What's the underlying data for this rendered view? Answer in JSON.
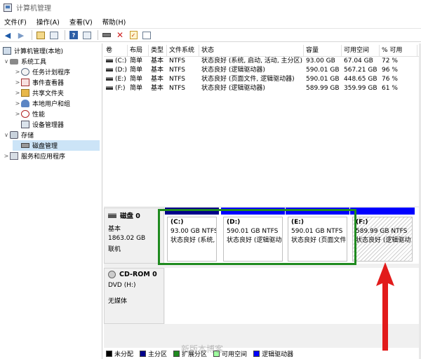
{
  "window": {
    "title": "计算机管理"
  },
  "menu": [
    "文件(F)",
    "操作(A)",
    "查看(V)",
    "帮助(H)"
  ],
  "toolbar": {
    "icons": [
      "back-arrow-icon",
      "forward-arrow-icon",
      "up-folder-icon",
      "show-hide-tree-icon",
      "help-icon",
      "properties-icon",
      "connect-drive-icon",
      "delete-icon",
      "checklist-icon",
      "panel-icon"
    ]
  },
  "tree": {
    "root": "计算机管理(本地)",
    "system_tools": "系统工具",
    "task_scheduler": "任务计划程序",
    "event_viewer": "事件查看器",
    "shared_folders": "共享文件夹",
    "local_users": "本地用户和组",
    "performance": "性能",
    "device_manager": "设备管理器",
    "storage": "存储",
    "disk_management": "磁盘管理",
    "services_apps": "服务和应用程序"
  },
  "volume_table": {
    "headers": [
      "卷",
      "布局",
      "类型",
      "文件系统",
      "状态",
      "容量",
      "可用空间",
      "% 可用"
    ],
    "rows": [
      [
        "(C:)",
        "简单",
        "基本",
        "NTFS",
        "状态良好 (系统, 启动, 活动, 主分区)",
        "93.00 GB",
        "67.04 GB",
        "72 %"
      ],
      [
        "(D:)",
        "简单",
        "基本",
        "NTFS",
        "状态良好 (逻辑驱动器)",
        "590.01 GB",
        "567.21 GB",
        "96 %"
      ],
      [
        "(E:)",
        "简单",
        "基本",
        "NTFS",
        "状态良好 (页面文件, 逻辑驱动器)",
        "590.01 GB",
        "448.65 GB",
        "76 %"
      ],
      [
        "(F:)",
        "简单",
        "基本",
        "NTFS",
        "状态良好 (逻辑驱动器)",
        "589.99 GB",
        "359.99 GB",
        "61 %"
      ]
    ]
  },
  "disk0": {
    "name": "磁盘 0",
    "type": "基本",
    "size": "1863.02 GB",
    "status": "联机",
    "partitions": [
      {
        "label": "(C:)",
        "size": "93.00 GB NTFS",
        "status": "状态良好 (系统, 启动",
        "color": "#00008b"
      },
      {
        "label": "(D:)",
        "size": "590.01 GB NTFS",
        "status": "状态良好 (逻辑驱动器",
        "color": "#0000ff"
      },
      {
        "label": "(E:)",
        "size": "590.01 GB NTFS",
        "status": "状态良好 (页面文件,",
        "color": "#0000ff"
      },
      {
        "label": "(F:)",
        "size": "589.99 GB NTFS",
        "status": "状态良好 (逻辑驱动",
        "color": "#0000ff"
      }
    ]
  },
  "cdrom0": {
    "name": "CD-ROM 0",
    "drive": "DVD (H:)",
    "media": "无媒体"
  },
  "legend": [
    {
      "label": "未分配",
      "color": "#000000"
    },
    {
      "label": "主分区",
      "color": "#00008b"
    },
    {
      "label": "扩展分区",
      "color": "#1f8a1f"
    },
    {
      "label": "可用空间",
      "color": "#9fff9f"
    },
    {
      "label": "逻辑驱动器",
      "color": "#0000ff"
    }
  ],
  "watermark": "新版本博客",
  "colors": {
    "selection": "#cce4f7",
    "annotation_arrow": "#e21b1b",
    "extended_border": "#1f8a1f"
  }
}
